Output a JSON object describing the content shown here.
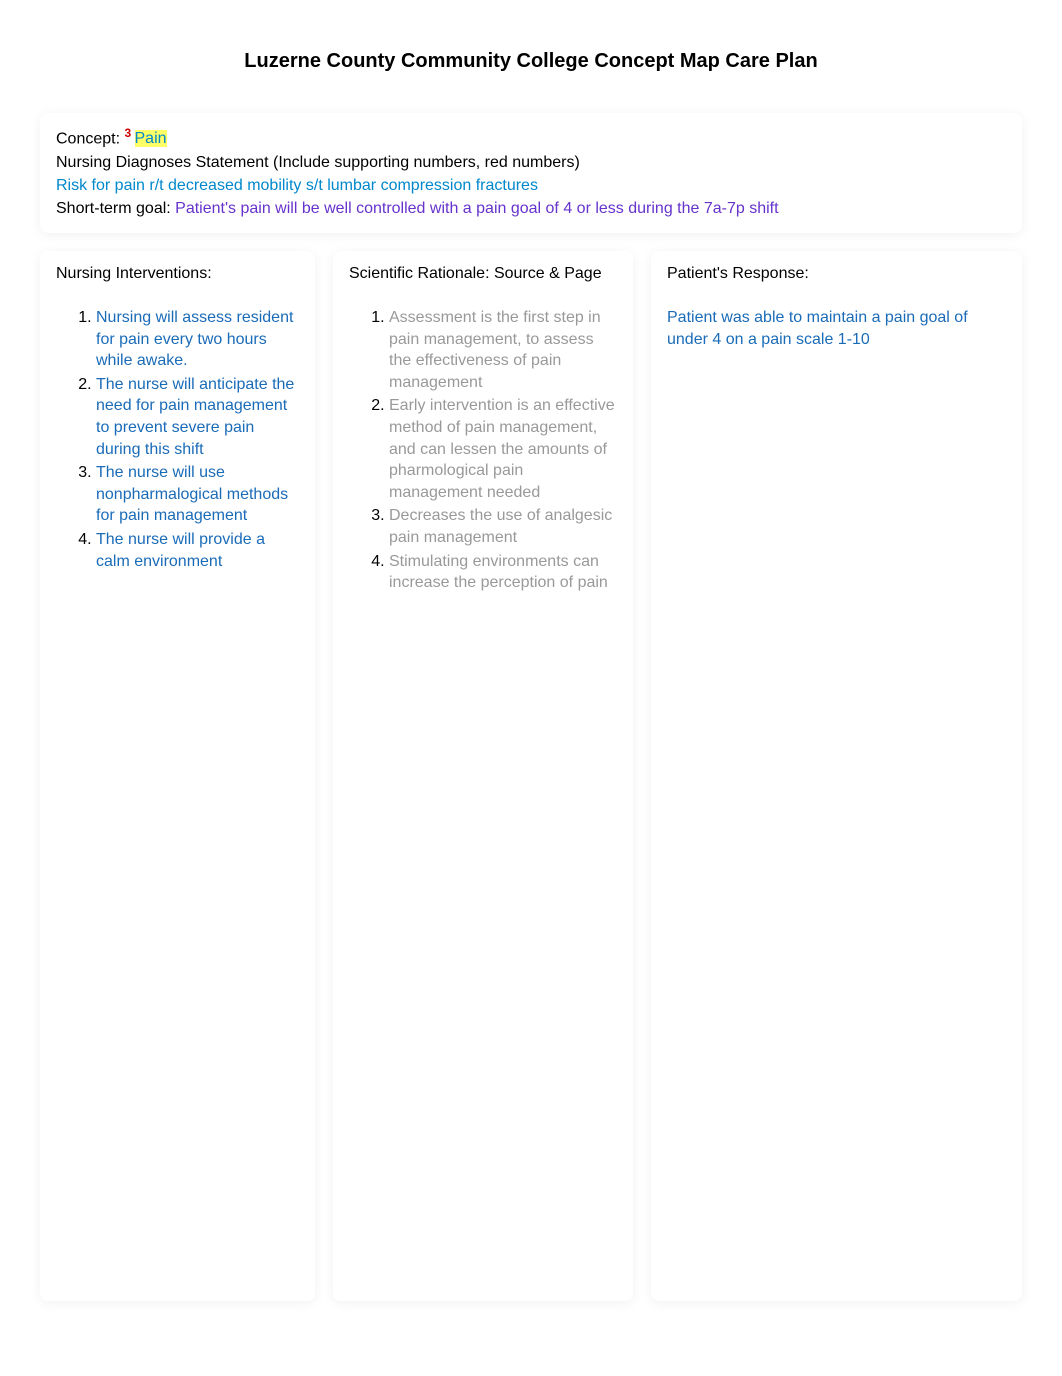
{
  "title": "Luzerne County Community College Concept Map Care Plan",
  "header": {
    "concept_label": "Concept: ",
    "concept_number": "3 ",
    "concept_value": "Pain",
    "diagnoses_label": "Nursing Diagnoses Statement (Include supporting numbers, red numbers)",
    "diagnoses_value": "Risk for pain r/t decreased mobility s/t lumbar compression fractures",
    "goal_label": "Short-term goal: ",
    "goal_value": "Patient's pain will be well controlled with a pain goal of 4 or less during the 7a-7p shift"
  },
  "columns": {
    "interventions": {
      "heading": "Nursing Interventions:",
      "items": [
        "Nursing will assess resident for pain every two hours while awake.",
        "The nurse will anticipate the need for pain management to prevent severe pain during this shift",
        "The nurse will use nonpharmalogical methods for pain management",
        "The nurse will provide a calm environment"
      ]
    },
    "rationale": {
      "heading": "Scientific Rationale: Source & Page",
      "items": [
        "Assessment is the first step in pain management, to assess the effectiveness of pain management",
        "Early intervention is an effective method of pain management, and can lessen the amounts of pharmological pain management needed",
        "Decreases the use of analgesic pain management",
        "Stimulating environments can increase the perception of pain"
      ]
    },
    "response": {
      "heading": "Patient's Response:",
      "text": "Patient was able to maintain a pain goal of under 4 on a pain scale 1-10"
    }
  }
}
